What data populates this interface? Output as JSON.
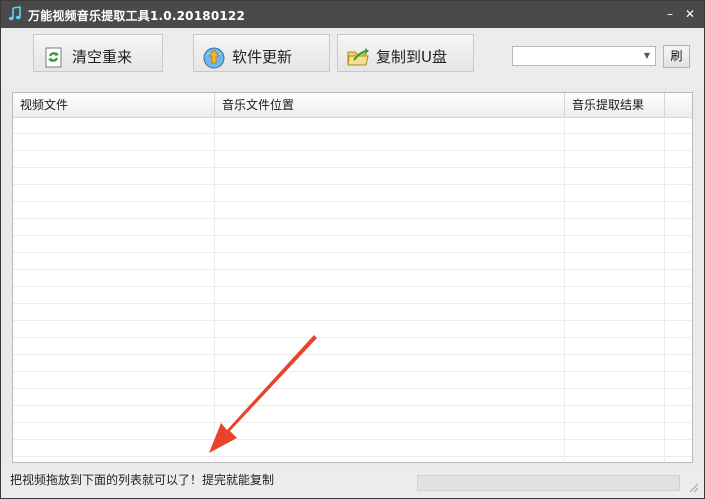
{
  "window": {
    "title": "万能视频音乐提取工具1.0.20180122",
    "minimize_symbol": "–",
    "close_symbol": "✕"
  },
  "toolbar": {
    "clear_label": "清空重来",
    "update_label": "软件更新",
    "copy_label": "复制到U盘",
    "drive_select_value": "",
    "refresh_label": "刷"
  },
  "table": {
    "headers": [
      "视频文件",
      "音乐文件位置",
      "音乐提取结果",
      ""
    ],
    "rows": []
  },
  "status": {
    "message": "把视频拖放到下面的列表就可以了！提完就能复制",
    "progress": 0
  },
  "colors": {
    "titlebar": "#4a4a4a",
    "annotation_arrow": "#e8442c"
  },
  "icons": {
    "title": "music-note-icon",
    "clear": "recycle-icon",
    "update": "globe-upload-icon",
    "copy": "folder-arrow-icon"
  }
}
